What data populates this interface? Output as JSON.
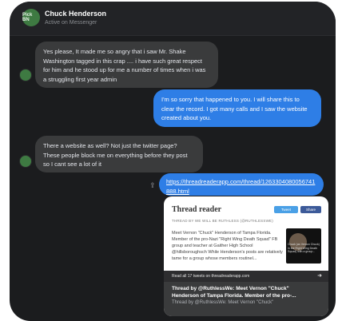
{
  "header": {
    "avatar_text": "Pick BN",
    "name": "Chuck Henderson",
    "status": "Active on Messenger"
  },
  "messages": [
    {
      "direction": "incoming",
      "text": "Yes please, It made me so angry that i saw Mr. Shake Washington tagged in this crap .... i have such great respect for him and he stood up for me a number of times when i was a struggling first year admin"
    },
    {
      "direction": "outgoing",
      "text": "I'm so sorry that happened to you. I will share this to clear the record. I got many calls and I saw the website created about you."
    },
    {
      "direction": "incoming",
      "text": "There a website as well? Not just the twitter page? These people block me on everything before they post so I cant see a lot of it"
    },
    {
      "direction": "outgoing",
      "link": "https://threadreaderapp.com/thread/1263304080056741888.html"
    }
  ],
  "link_preview": {
    "site_title": "Thread reader",
    "tweet_button": "Tweet",
    "share_button": "Share",
    "thread_by": "THREAD BY WE WILL BE RUTHLESS (@RUTHLESSWE)",
    "excerpt": "Meet Vernon \"Chuck\" Henderson of Tampa Florida. Member of the pro-Nazi \"Right Wing Death Squad\" FB group and teacher at Gaither High School @hillsboroughsch While Henderson's posts are relatively tame for a group whose members routinel...",
    "thumb_caption": "Chuck (as Vernon Chuck) in the Right Wing Death Squad) with a group...",
    "read_all": "Read all 17 tweets on threadreaderapp.com",
    "preview_title_1": "Thread by @RuthlessWe: Meet Vernon \"Chuck\"",
    "preview_title_2": "Henderson of Tampa Florida. Member of the pro-...",
    "preview_sub": "Thread by @RuthlessWe: Meet Vernon \"Chuck\""
  }
}
